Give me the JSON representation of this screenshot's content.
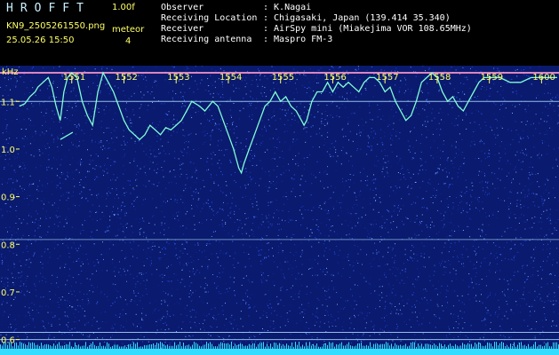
{
  "header": {
    "title": "HROFFT",
    "version": "1.00f",
    "filename": "KN9_2505261550.png",
    "datetime": "25.05.26 15:50",
    "meteor_label": "meteor",
    "meteor_count": "4",
    "info": [
      {
        "label": "Observer",
        "value": ": K.Nagai"
      },
      {
        "label": "Receiving Location",
        "value": ": Chigasaki, Japan (139.414 35.340)"
      },
      {
        "label": "Receiver",
        "value": ": AirSpy mini (Miakejima VOR 108.65MHz)"
      },
      {
        "label": "Receiving antenna",
        "value": ": Maspro FM-3"
      }
    ]
  },
  "spectrogram": {
    "y_unit": "kHz",
    "y_ticks": [
      "1.1",
      "1.0",
      "0.9",
      "0.8",
      "0.7",
      "0.6"
    ],
    "y_values": [
      1.1,
      1.0,
      0.9,
      0.8,
      0.7,
      0.6
    ],
    "y_range": [
      0.575,
      1.175
    ],
    "x_ticks": [
      "1551",
      "1552",
      "1553",
      "1554",
      "1555",
      "1556",
      "1557",
      "1558",
      "1559",
      "1600"
    ],
    "x_values": [
      1,
      2,
      3,
      4,
      5,
      6,
      7,
      8,
      9,
      10
    ],
    "x_range_minutes": [
      0,
      10.3
    ],
    "colors": {
      "background": "#0a1a6e",
      "label": "#ffff66",
      "trace": "#7fffd4",
      "reference_line": "#aaddff",
      "baseline": "#33ddff"
    },
    "reference_lines_khz": [
      1.16,
      1.1,
      0.81,
      0.615,
      0.6
    ],
    "trace_khz": [
      [
        0.0,
        1.09
      ],
      [
        0.1,
        1.095
      ],
      [
        0.2,
        1.11
      ],
      [
        0.3,
        1.12
      ],
      [
        0.35,
        1.13
      ],
      [
        0.45,
        1.14
      ],
      [
        0.55,
        1.15
      ],
      [
        0.62,
        1.13
      ],
      [
        0.7,
        1.09
      ],
      [
        0.78,
        1.06
      ],
      [
        0.85,
        1.12
      ],
      [
        0.92,
        1.15
      ],
      [
        1.0,
        1.16
      ],
      [
        1.1,
        1.15
      ],
      [
        1.2,
        1.1
      ],
      [
        1.3,
        1.07
      ],
      [
        1.4,
        1.05
      ],
      [
        1.5,
        1.12
      ],
      [
        1.6,
        1.16
      ],
      [
        1.7,
        1.14
      ],
      [
        1.8,
        1.12
      ],
      [
        1.9,
        1.09
      ],
      [
        2.0,
        1.06
      ],
      [
        2.1,
        1.04
      ],
      [
        2.2,
        1.03
      ],
      [
        2.3,
        1.02
      ],
      [
        2.4,
        1.03
      ],
      [
        2.5,
        1.05
      ],
      [
        2.6,
        1.04
      ],
      [
        2.7,
        1.03
      ],
      [
        2.8,
        1.045
      ],
      [
        2.9,
        1.04
      ],
      [
        3.0,
        1.05
      ],
      [
        3.1,
        1.06
      ],
      [
        3.2,
        1.08
      ],
      [
        3.3,
        1.1
      ],
      [
        3.45,
        1.09
      ],
      [
        3.55,
        1.08
      ],
      [
        3.7,
        1.1
      ],
      [
        3.8,
        1.09
      ],
      [
        3.9,
        1.06
      ],
      [
        4.0,
        1.03
      ],
      [
        4.1,
        1.0
      ],
      [
        4.2,
        0.96
      ],
      [
        4.25,
        0.95
      ],
      [
        4.3,
        0.97
      ],
      [
        4.4,
        1.0
      ],
      [
        4.5,
        1.03
      ],
      [
        4.6,
        1.06
      ],
      [
        4.7,
        1.09
      ],
      [
        4.8,
        1.1
      ],
      [
        4.9,
        1.12
      ],
      [
        5.0,
        1.1
      ],
      [
        5.1,
        1.11
      ],
      [
        5.2,
        1.09
      ],
      [
        5.3,
        1.08
      ],
      [
        5.4,
        1.06
      ],
      [
        5.45,
        1.05
      ],
      [
        5.5,
        1.06
      ],
      [
        5.6,
        1.1
      ],
      [
        5.7,
        1.12
      ],
      [
        5.8,
        1.12
      ],
      [
        5.9,
        1.14
      ],
      [
        6.0,
        1.12
      ],
      [
        6.1,
        1.14
      ],
      [
        6.2,
        1.13
      ],
      [
        6.3,
        1.14
      ],
      [
        6.4,
        1.13
      ],
      [
        6.5,
        1.12
      ],
      [
        6.6,
        1.14
      ],
      [
        6.7,
        1.15
      ],
      [
        6.8,
        1.15
      ],
      [
        6.9,
        1.14
      ],
      [
        7.0,
        1.12
      ],
      [
        7.1,
        1.13
      ],
      [
        7.2,
        1.1
      ],
      [
        7.3,
        1.08
      ],
      [
        7.4,
        1.06
      ],
      [
        7.5,
        1.07
      ],
      [
        7.6,
        1.1
      ],
      [
        7.7,
        1.14
      ],
      [
        7.8,
        1.15
      ],
      [
        7.9,
        1.16
      ],
      [
        8.0,
        1.15
      ],
      [
        8.1,
        1.12
      ],
      [
        8.2,
        1.1
      ],
      [
        8.3,
        1.11
      ],
      [
        8.4,
        1.09
      ],
      [
        8.5,
        1.08
      ],
      [
        8.6,
        1.1
      ],
      [
        8.7,
        1.12
      ],
      [
        8.8,
        1.14
      ],
      [
        8.9,
        1.15
      ],
      [
        9.0,
        1.15
      ],
      [
        9.2,
        1.15
      ],
      [
        9.4,
        1.14
      ],
      [
        9.6,
        1.14
      ],
      [
        9.8,
        1.15
      ],
      [
        10.0,
        1.15
      ],
      [
        10.3,
        1.15
      ]
    ],
    "meteor_khz": [
      [
        0.78,
        1.02
      ],
      [
        1.02,
        1.035
      ]
    ]
  }
}
